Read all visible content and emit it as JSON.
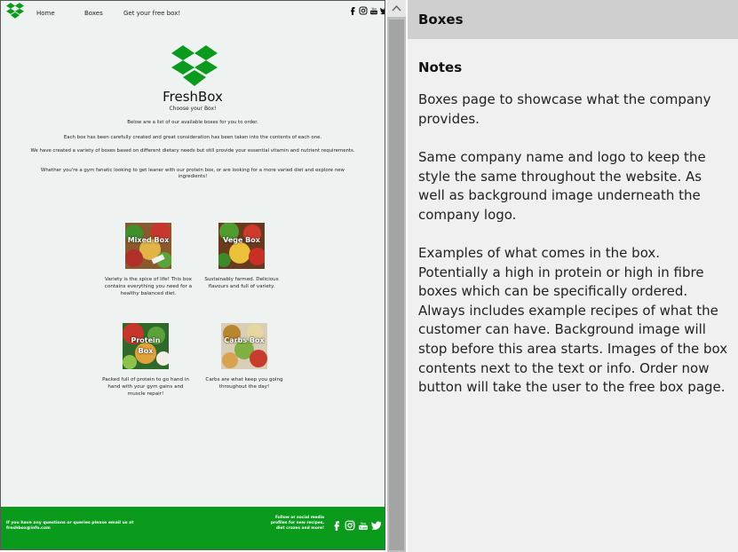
{
  "mockup": {
    "nav": {
      "home_label": "Home",
      "boxes_label": "Boxes",
      "freebox_label": "Get your free box!",
      "social_icons": [
        "facebook-icon",
        "instagram-icon",
        "youtube-icon",
        "twitter-icon"
      ]
    },
    "brand": "FreshBox",
    "tagline": "Choose your Box!",
    "intro": [
      "Below are a list of our available boxes for you to order.",
      "Each box has been carefully created and great consideration has been taken into the contents of each one.",
      "We have created a variety of boxes based on different dietary needs but still provide your essential vitamin and nutrient requirements.",
      "Whether you're a gym fanatic looking to get leaner with our protein box, or are looking for a more varied diet and explore new ingredients!"
    ],
    "boxes": [
      {
        "label": "Mixed Box",
        "description": "Variety is the spice of life! This box contains everything you need for a healthy balanced diet."
      },
      {
        "label": "Vege Box",
        "description": "Sustainably farmed. Delicious flavours and full of variety."
      },
      {
        "label": "Protein Box",
        "description": "Packed full of protein to go hand in hand with your gym gains and muscle repair!"
      },
      {
        "label": "Carbs Box",
        "description": "Carbs are what keep you going throughout the day!"
      }
    ],
    "footer": {
      "contact_text": "If you have any questions or queries please email us at freshbox@info.com",
      "follow_text": "Follow or social media profiles for new recipes, diet crazes and more!"
    },
    "colors": {
      "brand_green": "#0a9a1c",
      "page_background": "#eef3f1"
    }
  },
  "panel": {
    "title": "Boxes",
    "notes_heading": "Notes",
    "paragraphs": [
      "Boxes page to showcase what the company provides.",
      "Same company name and logo to keep the style the same throughout the website. As well as background image underneath the company logo.",
      "Examples of what comes in the box. Potentially a high in protein or high in fibre boxes which can be specifically ordered. Always includes example recipes of what the customer can have. Background image will stop before this area starts. Images of the box contents next to the text or info. Order now button will take the user to the free box page."
    ]
  }
}
